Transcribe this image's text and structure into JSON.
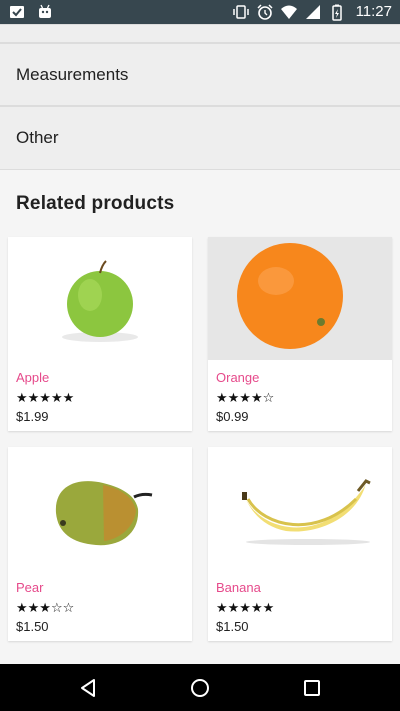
{
  "status_bar": {
    "time": "11:27",
    "left_icons": [
      "inbox-check-icon",
      "android-icon"
    ],
    "right_icons": [
      "vibrate-icon",
      "alarm-icon",
      "wifi-icon",
      "signal-icon",
      "battery-icon"
    ]
  },
  "sections": [
    {
      "label": "Measurements"
    },
    {
      "label": "Other"
    }
  ],
  "related": {
    "title": "Related products",
    "products": [
      {
        "name": "Apple",
        "rating": "★★★★★",
        "price": "$1.99",
        "image": "apple"
      },
      {
        "name": "Orange",
        "rating": "★★★★☆",
        "price": "$0.99",
        "image": "orange"
      },
      {
        "name": "Pear",
        "rating": "★★★☆☆",
        "price": "$1.50",
        "image": "pear"
      },
      {
        "name": "Banana",
        "rating": "★★★★★",
        "price": "$1.50",
        "image": "banana"
      }
    ]
  },
  "nav_bar": {
    "buttons": [
      "back-icon",
      "home-icon",
      "recents-icon"
    ]
  },
  "colors": {
    "status_bar": "#37474f",
    "accent_pink": "#e64a8b",
    "section_bg": "#eeeeee",
    "page_bg": "#f5f5f5"
  }
}
